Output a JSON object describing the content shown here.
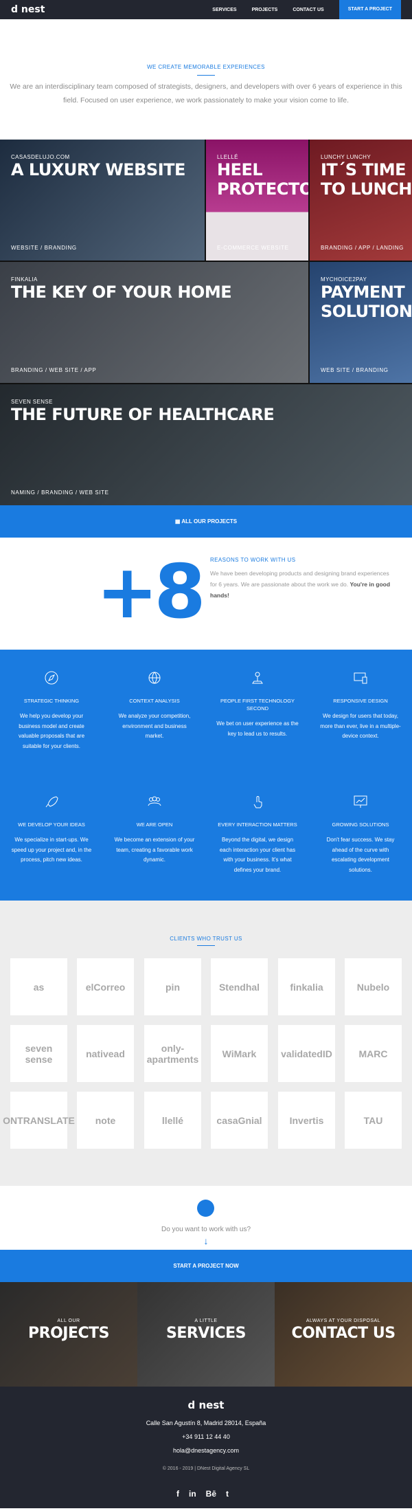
{
  "nav": {
    "logo": "d nest",
    "items": [
      "SERVICES",
      "PROJECTS",
      "CONTACT US"
    ],
    "cta": "START A PROJECT"
  },
  "intro": {
    "kicker": "WE CREATE MEMORABLE EXPERIENCES",
    "text": "We are an interdisciplinary team composed of strategists, designers, and developers with over 6 years of experience in this field. Focused on user experience, we work passionately to make your vision come to life."
  },
  "projects": [
    {
      "client": "CASASDELUJO.COM",
      "title": "A LUXURY WEBSITE",
      "tags": "WEBSITE / BRANDING",
      "color": "#2d3f55"
    },
    {
      "client": "LLELLÉ",
      "title": "HEEL PROTECTORS",
      "tags": "E-COMMERCE WEBSITE",
      "color": "#8a1366"
    },
    {
      "client": "LUNCHY LUNCHY",
      "title": "IT´S TIME TO LUNCH",
      "tags": "BRANDING / APP / LANDING",
      "color": "#7a2027"
    },
    {
      "client": "FINKALIA",
      "title": "THE KEY OF YOUR HOME",
      "tags": "BRANDING / WEB SITE / APP",
      "color": "#3a3f47"
    },
    {
      "client": "MYCHOICE2PAY",
      "title": "PAYMENT SOLUTIONS",
      "tags": "WEB SITE / BRANDING",
      "color": "#2d4d7a"
    },
    {
      "client": "SEVEN SENSE",
      "title": "THE FUTURE OF HEALTHCARE",
      "tags": "NAMING / BRANDING / WEB SITE",
      "color": "#2a3036"
    }
  ],
  "all_projects": "ALL OUR PROJECTS",
  "why": {
    "number": "+8",
    "kicker": "REASONS TO WORK WITH US",
    "text": "We have been developing products and designing brand experiences for 6 years. We are passionate about the work we do.",
    "bold": "You're in good hands!"
  },
  "features": [
    {
      "title": "STRATEGIC THINKING",
      "icon": "compass-icon",
      "desc": "We help you develop your business model and create valuable proposals that are suitable for your clients."
    },
    {
      "title": "CONTEXT ANALYSIS",
      "icon": "globe-icon",
      "desc": "We analyze your competition, environment and business market."
    },
    {
      "title": "PEOPLE FIRST TECHNOLOGY SECOND",
      "icon": "joystick-icon",
      "desc": "We bet on user experience as the key to lead us to results."
    },
    {
      "title": "RESPONSIVE DESIGN",
      "icon": "devices-icon",
      "desc": "We design for users that today, more than ever, live in a multiple-device context."
    },
    {
      "title": "WE DEVELOP YOUR IDEAS",
      "icon": "rocket-icon",
      "desc": "We specialize in start-ups. We speed up your project and, in the process, pitch new ideas."
    },
    {
      "title": "WE ARE OPEN",
      "icon": "team-icon",
      "desc": "We become an extension of your team, creating a favorable work dynamic."
    },
    {
      "title": "EVERY INTERACTION MATTERS",
      "icon": "tap-icon",
      "desc": "Beyond the digital, we design each interaction your client has with your business. It's what defines your brand."
    },
    {
      "title": "GROWING SOLUTIONS",
      "icon": "chart-icon",
      "desc": "Don't fear success. We stay ahead of the curve with escalating development solutions."
    }
  ],
  "clients": {
    "kicker": "CLIENTS WHO TRUST US",
    "logos": [
      "as",
      "elCorreo",
      "pin",
      "Stendhal",
      "finkalia",
      "Nubelo",
      "seven sense",
      "nativead",
      "only- apartments",
      "WiMark",
      "validatedID",
      "MARC",
      "ONTRANSLATE",
      "note",
      "llellé",
      "casaGnial",
      "Invertis",
      "TAU"
    ]
  },
  "cta": {
    "question": "Do you want to work with us?",
    "arrow": "↓",
    "button": "START A PROJECT NOW"
  },
  "panels": [
    {
      "small": "ALL OUR",
      "big": "PROJECTS"
    },
    {
      "small": "A LITTLE",
      "big": "SERVICES"
    },
    {
      "small": "ALWAYS AT YOUR DISPOSAL",
      "big": "CONTACT US"
    }
  ],
  "footer": {
    "logo": "d nest",
    "address": "Calle San Agustín 8, Madrid 28014, España",
    "phone": "+34 911 12 44 40",
    "email": "hola@dnestagency.com",
    "copyright": "© 2016 - 2019 | DNest Digital Agency SL",
    "social": [
      "f",
      "in",
      "Bē",
      "t"
    ]
  }
}
